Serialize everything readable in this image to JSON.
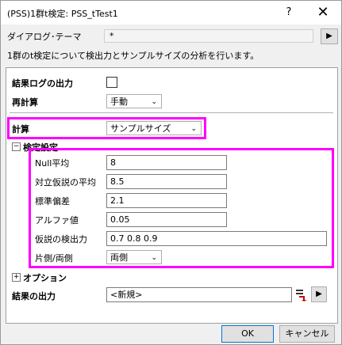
{
  "window": {
    "title": "(PSS)1群t検定: PSS_tTest1",
    "help_label": "?",
    "close_label": "✕"
  },
  "theme": {
    "label": "ダイアログ･テーマ",
    "value": "*",
    "arrow": "▶"
  },
  "description": "1群のt検定について検出力とサンプルサイズの分析を行います。",
  "rows": {
    "log_output": {
      "label": "結果ログの出力"
    },
    "recalc": {
      "label": "再計算",
      "value": "手動"
    },
    "calc": {
      "label": "計算",
      "value": "サンプルサイズ"
    }
  },
  "test_settings": {
    "label": "検定設定",
    "toggle": "−",
    "fields": {
      "null_mean": {
        "label": "Null平均",
        "value": "8"
      },
      "alt_mean": {
        "label": "対立仮説の平均",
        "value": "8.5"
      },
      "std_dev": {
        "label": "標準偏差",
        "value": "2.1"
      },
      "alpha": {
        "label": "アルファ値",
        "value": "0.05"
      },
      "power": {
        "label": "仮説の検出力",
        "value": "0.7 0.8 0.9"
      },
      "tail": {
        "label": "片側/両側",
        "value": "両側"
      }
    }
  },
  "options": {
    "label": "オプション",
    "toggle": "+"
  },
  "output": {
    "label": "結果の出力",
    "value": "<新規>",
    "arrow": "▶"
  },
  "buttons": {
    "ok": "OK",
    "cancel": "キャンセル"
  },
  "colors": {
    "highlight": "#ff00ff",
    "focus": "#0078d7"
  }
}
